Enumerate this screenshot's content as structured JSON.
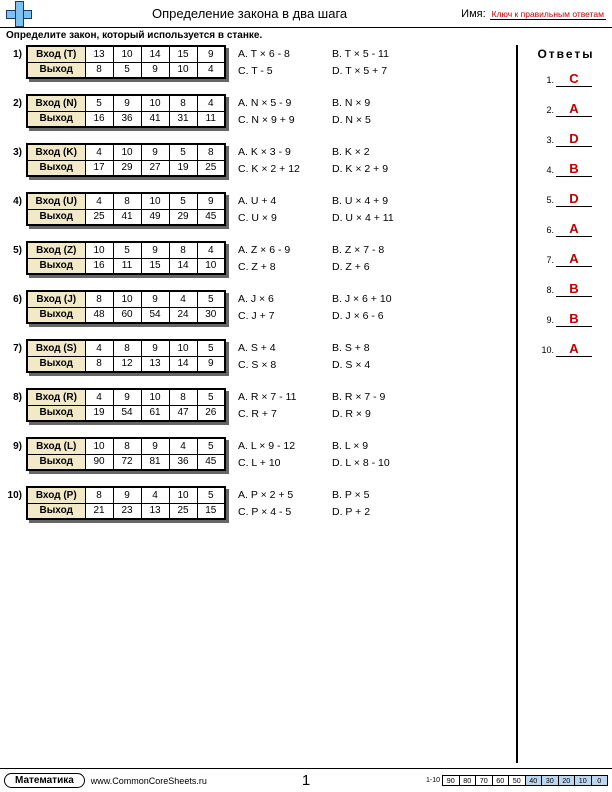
{
  "header": {
    "title": "Определение закона в два шага",
    "name_label": "Имя:",
    "answer_key_text": "Ключ к правильным ответам"
  },
  "instruction": "Определите закон, который используется в станке.",
  "answers_title": "Ответы",
  "problems": [
    {
      "num": "1)",
      "var": "T",
      "in_label": "Вход (T)",
      "out_label": "Выход",
      "in": [
        13,
        10,
        14,
        15,
        9
      ],
      "out": [
        8,
        5,
        9,
        10,
        4
      ],
      "opts": [
        "A. T × 6 - 8",
        "B. T × 5 - 11",
        "C. T - 5",
        "D. T × 5 + 7"
      ]
    },
    {
      "num": "2)",
      "var": "N",
      "in_label": "Вход (N)",
      "out_label": "Выход",
      "in": [
        5,
        9,
        10,
        8,
        4
      ],
      "out": [
        16,
        36,
        41,
        31,
        11
      ],
      "opts": [
        "A. N × 5 - 9",
        "B. N × 9",
        "C. N × 9 + 9",
        "D. N × 5"
      ]
    },
    {
      "num": "3)",
      "var": "K",
      "in_label": "Вход (K)",
      "out_label": "Выход",
      "in": [
        4,
        10,
        9,
        5,
        8
      ],
      "out": [
        17,
        29,
        27,
        19,
        25
      ],
      "opts": [
        "A. K × 3 - 9",
        "B. K × 2",
        "C. K × 2 + 12",
        "D. K × 2 + 9"
      ]
    },
    {
      "num": "4)",
      "var": "U",
      "in_label": "Вход (U)",
      "out_label": "Выход",
      "in": [
        4,
        8,
        10,
        5,
        9
      ],
      "out": [
        25,
        41,
        49,
        29,
        45
      ],
      "opts": [
        "A. U + 4",
        "B. U × 4 + 9",
        "C. U × 9",
        "D. U × 4 + 11"
      ]
    },
    {
      "num": "5)",
      "var": "Z",
      "in_label": "Вход (Z)",
      "out_label": "Выход",
      "in": [
        10,
        5,
        9,
        8,
        4
      ],
      "out": [
        16,
        11,
        15,
        14,
        10
      ],
      "opts": [
        "A. Z × 6 - 9",
        "B. Z × 7 - 8",
        "C. Z + 8",
        "D. Z + 6"
      ]
    },
    {
      "num": "6)",
      "var": "J",
      "in_label": "Вход (J)",
      "out_label": "Выход",
      "in": [
        8,
        10,
        9,
        4,
        5
      ],
      "out": [
        48,
        60,
        54,
        24,
        30
      ],
      "opts": [
        "A. J × 6",
        "B. J × 6 + 10",
        "C. J + 7",
        "D. J × 6 - 6"
      ]
    },
    {
      "num": "7)",
      "var": "S",
      "in_label": "Вход (S)",
      "out_label": "Выход",
      "in": [
        4,
        8,
        9,
        10,
        5
      ],
      "out": [
        8,
        12,
        13,
        14,
        9
      ],
      "opts": [
        "A. S + 4",
        "B. S + 8",
        "C. S × 8",
        "D. S × 4"
      ]
    },
    {
      "num": "8)",
      "var": "R",
      "in_label": "Вход (R)",
      "out_label": "Выход",
      "in": [
        4,
        9,
        10,
        8,
        5
      ],
      "out": [
        19,
        54,
        61,
        47,
        26
      ],
      "opts": [
        "A. R × 7 - 11",
        "B. R × 7 - 9",
        "C. R + 7",
        "D. R × 9"
      ]
    },
    {
      "num": "9)",
      "var": "L",
      "in_label": "Вход (L)",
      "out_label": "Выход",
      "in": [
        10,
        8,
        9,
        4,
        5
      ],
      "out": [
        90,
        72,
        81,
        36,
        45
      ],
      "opts": [
        "A. L × 9 - 12",
        "B. L × 9",
        "C. L + 10",
        "D. L × 8 - 10"
      ]
    },
    {
      "num": "10)",
      "var": "P",
      "in_label": "Вход (P)",
      "out_label": "Выход",
      "in": [
        8,
        9,
        4,
        10,
        5
      ],
      "out": [
        21,
        23,
        13,
        25,
        15
      ],
      "opts": [
        "A. P × 2 + 5",
        "B. P × 5",
        "C. P × 4 - 5",
        "D. P + 2"
      ]
    }
  ],
  "answers": [
    "C",
    "A",
    "D",
    "B",
    "D",
    "A",
    "A",
    "B",
    "B",
    "A"
  ],
  "footer": {
    "subject": "Математика",
    "url": "www.CommonCoreSheets.ru",
    "page": "1",
    "score_label": "1-10",
    "score_top": [
      "90",
      "80",
      "70",
      "60",
      "50",
      "40",
      "30",
      "20",
      "10",
      "0"
    ]
  }
}
